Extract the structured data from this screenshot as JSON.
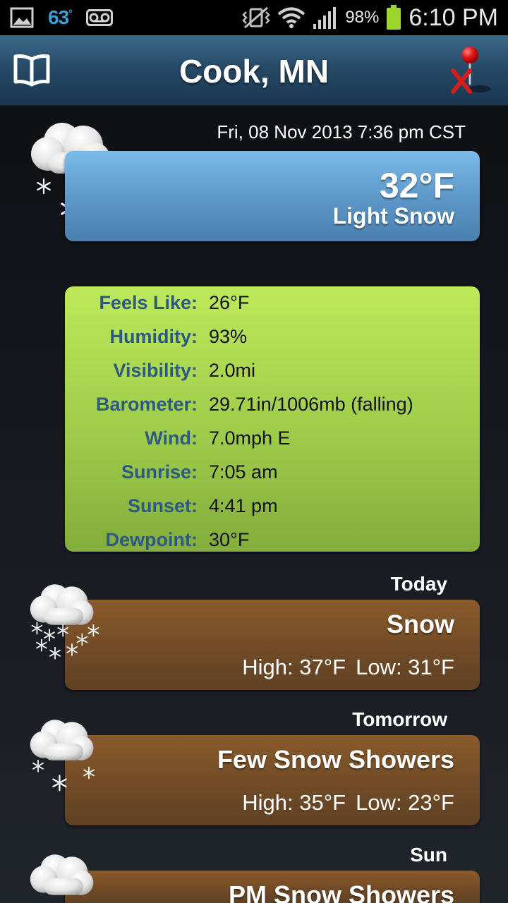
{
  "status_bar": {
    "temperature": "63",
    "degree_symbol": "°",
    "battery_percent": "98%",
    "time": "6:10 PM"
  },
  "header": {
    "title": "Cook, MN"
  },
  "current": {
    "observed": "Fri, 08 Nov 2013 7:36 pm CST",
    "temperature": "32°F",
    "condition": "Light Snow",
    "icon": "cloud-snow-icon"
  },
  "details": [
    {
      "label": "Feels Like:",
      "value": "26°F"
    },
    {
      "label": "Humidity:",
      "value": "93%"
    },
    {
      "label": "Visibility:",
      "value": "2.0mi"
    },
    {
      "label": "Barometer:",
      "value": "29.71in/1006mb (falling)"
    },
    {
      "label": "Wind:",
      "value": "7.0mph E"
    },
    {
      "label": "Sunrise:",
      "value": "7:05 am"
    },
    {
      "label": "Sunset:",
      "value": "4:41 pm"
    },
    {
      "label": "Dewpoint:",
      "value": "30°F"
    }
  ],
  "forecast": [
    {
      "day": "Today",
      "condition": "Snow",
      "high": "High: 37°F",
      "low": "Low: 31°F",
      "icon": "cloud-snow-icon"
    },
    {
      "day": "Tomorrow",
      "condition": "Few Snow Showers",
      "high": "High: 35°F",
      "low": "Low: 23°F",
      "icon": "cloud-snow-icon"
    },
    {
      "day": "Sun",
      "condition": "PM Snow Showers",
      "high": "",
      "low": "",
      "icon": "cloud-snow-icon"
    }
  ],
  "colors": {
    "title_bar": "#264a66",
    "current_box": "#5b96c6",
    "details_box": "#9fcc4a",
    "detail_label": "#2e5a82",
    "forecast_box": "#6f4a26"
  }
}
